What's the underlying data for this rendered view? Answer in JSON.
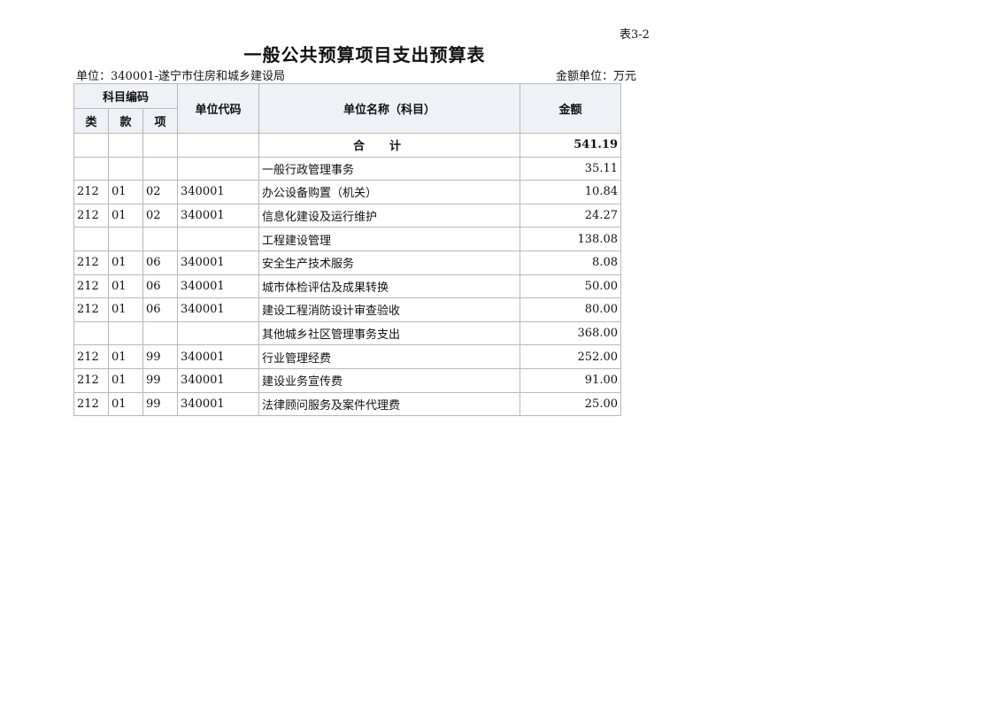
{
  "table_number": "表3-2",
  "title": "一般公共预算项目支出预算表",
  "unit_line": "单位：340001-遂宁市住房和城乡建设局",
  "amount_unit": "金额单位：万元",
  "header": {
    "subject_code": "科目编码",
    "lei": "类",
    "kuan": "款",
    "xiang": "项",
    "unit_code": "单位代码",
    "unit_name": "单位名称（科目）",
    "amount": "金额"
  },
  "total": {
    "label": "合计",
    "amount": "541.19"
  },
  "rows": [
    {
      "lei": "",
      "kuan": "",
      "xiang": "",
      "code": "",
      "name": "一般行政管理事务",
      "amount": "35.11"
    },
    {
      "lei": "212",
      "kuan": "01",
      "xiang": "02",
      "code": "340001",
      "name": "办公设备购置（机关）",
      "amount": "10.84"
    },
    {
      "lei": "212",
      "kuan": "01",
      "xiang": "02",
      "code": "340001",
      "name": "信息化建设及运行维护",
      "amount": "24.27"
    },
    {
      "lei": "",
      "kuan": "",
      "xiang": "",
      "code": "",
      "name": "工程建设管理",
      "amount": "138.08"
    },
    {
      "lei": "212",
      "kuan": "01",
      "xiang": "06",
      "code": "340001",
      "name": "安全生产技术服务",
      "amount": "8.08"
    },
    {
      "lei": "212",
      "kuan": "01",
      "xiang": "06",
      "code": "340001",
      "name": "城市体检评估及成果转换",
      "amount": "50.00"
    },
    {
      "lei": "212",
      "kuan": "01",
      "xiang": "06",
      "code": "340001",
      "name": "建设工程消防设计审查验收",
      "amount": "80.00"
    },
    {
      "lei": "",
      "kuan": "",
      "xiang": "",
      "code": "",
      "name": "其他城乡社区管理事务支出",
      "amount": "368.00"
    },
    {
      "lei": "212",
      "kuan": "01",
      "xiang": "99",
      "code": "340001",
      "name": "行业管理经费",
      "amount": "252.00"
    },
    {
      "lei": "212",
      "kuan": "01",
      "xiang": "99",
      "code": "340001",
      "name": "建设业务宣传费",
      "amount": "91.00"
    },
    {
      "lei": "212",
      "kuan": "01",
      "xiang": "99",
      "code": "340001",
      "name": "法律顾问服务及案件代理费",
      "amount": "25.00"
    }
  ]
}
